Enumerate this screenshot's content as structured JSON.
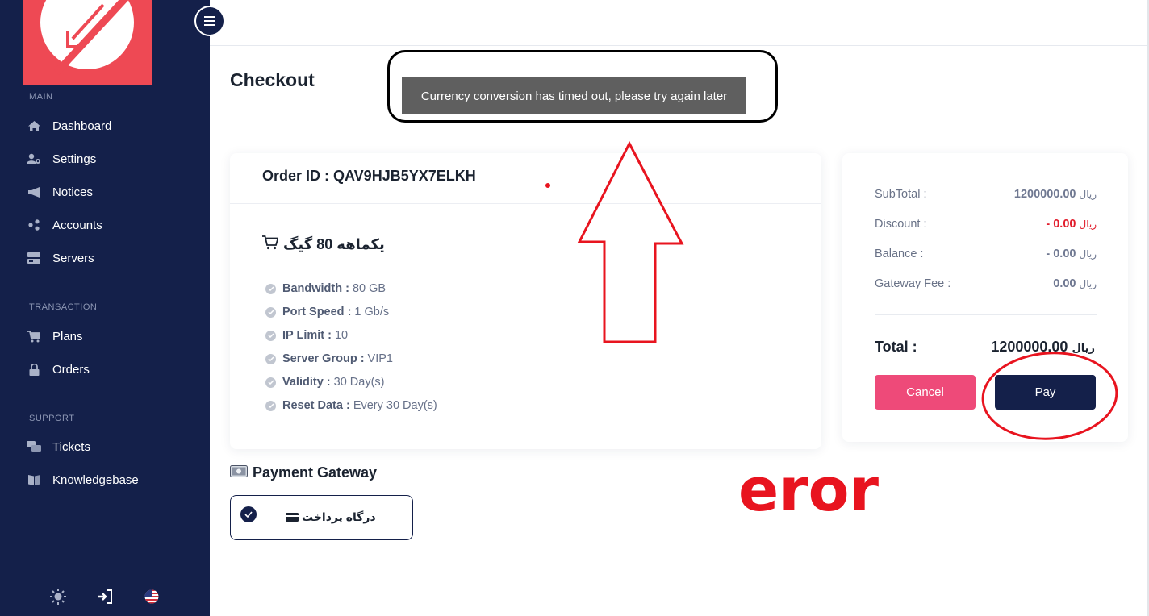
{
  "sidebar": {
    "sections": {
      "main": "MAIN",
      "transaction": "TRANSACTION",
      "support": "SUPPORT"
    },
    "items": [
      {
        "label": "Dashboard",
        "icon": "home-icon"
      },
      {
        "label": "Settings",
        "icon": "user-gear-icon"
      },
      {
        "label": "Notices",
        "icon": "megaphone-icon"
      },
      {
        "label": "Accounts",
        "icon": "share-nodes-icon"
      },
      {
        "label": "Servers",
        "icon": "server-icon"
      },
      {
        "label": "Plans",
        "icon": "cart-icon"
      },
      {
        "label": "Orders",
        "icon": "lock-icon"
      },
      {
        "label": "Tickets",
        "icon": "chat-icon"
      },
      {
        "label": "Knowledgebase",
        "icon": "book-icon"
      }
    ],
    "bottom_icons": [
      "sun-icon",
      "sign-in-icon",
      "us-flag-icon"
    ]
  },
  "page": {
    "title": "Checkout"
  },
  "toast": {
    "message": "Currency conversion has timed out, please try again later"
  },
  "order": {
    "id_label": "Order ID : QAV9HJB5YX7ELKH",
    "plan_name": "یکماهه 80 گیگ",
    "features": [
      {
        "label": "Bandwidth :",
        "value": "80 GB"
      },
      {
        "label": "Port Speed :",
        "value": "1 Gb/s"
      },
      {
        "label": "IP Limit :",
        "value": "10"
      },
      {
        "label": "Server Group :",
        "value": "VIP1"
      },
      {
        "label": "Validity :",
        "value": "30 Day(s)"
      },
      {
        "label": "Reset Data :",
        "value": "Every 30 Day(s)"
      }
    ]
  },
  "summary": {
    "currency": "ریال",
    "subtotal": {
      "label": "SubTotal :",
      "value": "1200000.00"
    },
    "discount": {
      "label": "Discount :",
      "value": "- 0.00"
    },
    "balance": {
      "label": "Balance :",
      "value": "- 0.00"
    },
    "gateway_fee": {
      "label": "Gateway Fee :",
      "value": "0.00"
    },
    "total": {
      "label": "Total :",
      "value": "1200000.00"
    },
    "cancel_label": "Cancel",
    "pay_label": "Pay"
  },
  "payment_gateway": {
    "title": "Payment Gateway",
    "option_label": "درگاه پرداخت"
  },
  "annotation": {
    "text": "eror",
    "color": "#e8141f"
  },
  "colors": {
    "sidebar": "#14204a",
    "brand": "#ee4954",
    "cancel": "#ee4a79",
    "pay": "#14204a"
  }
}
